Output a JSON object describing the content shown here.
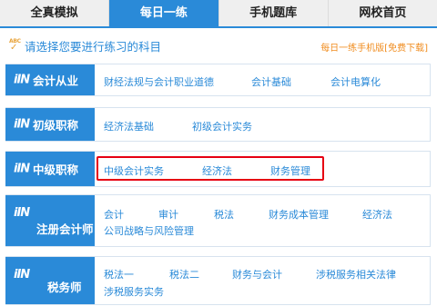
{
  "tabs": [
    "全真模拟",
    "每日一练",
    "手机题库",
    "网校首页"
  ],
  "prompt": {
    "icon": "abc-check-icon",
    "text": "请选择您要进行练习的科目",
    "mobile_link": "每日一练手机版[免费下载]"
  },
  "categories": [
    {
      "label": "会计从业",
      "subjects": [
        "财经法规与会计职业道德",
        "会计基础",
        "会计电算化"
      ]
    },
    {
      "label": "初级职称",
      "subjects": [
        "经济法基础",
        "初级会计实务"
      ]
    },
    {
      "label": "中级职称",
      "subjects": [
        "中级会计实务",
        "经济法",
        "财务管理"
      ]
    },
    {
      "label": "注册会计师",
      "subjects": [
        "会计",
        "审计",
        "税法",
        "财务成本管理",
        "经济法",
        "公司战略与风险管理"
      ]
    },
    {
      "label": "税务师",
      "subjects": [
        "税法一",
        "税法二",
        "财务与会计",
        "涉税服务相关法律",
        "涉税服务实务"
      ]
    }
  ],
  "colors": {
    "primary": "#2a8ad8",
    "highlight": "#e60012",
    "accent": "#f08c1e"
  }
}
